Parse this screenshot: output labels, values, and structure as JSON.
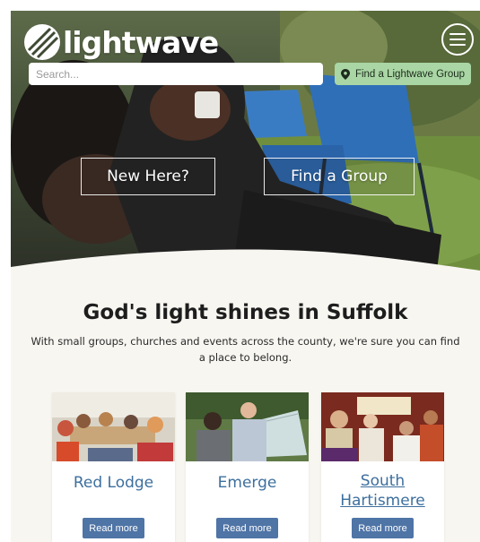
{
  "header": {
    "logo_text": "lightwave",
    "search": {
      "placeholder": "Search...",
      "value": ""
    },
    "find_group_label": "Find a Lightwave Group"
  },
  "hero": {
    "buttons": [
      {
        "label": "New Here?"
      },
      {
        "label": "Find a Group"
      }
    ]
  },
  "main": {
    "title": "God's light shines in Suffolk",
    "intro": "With small groups, churches and events across the county, we're sure you can find a place to belong.",
    "cards": [
      {
        "title": "Red Lodge",
        "button": "Read more"
      },
      {
        "title": "Emerge",
        "button": "Read more"
      },
      {
        "title": "South Hartismere",
        "button": "Read more"
      }
    ]
  },
  "colors": {
    "accent_green": "#a9d6a4",
    "link_blue": "#3d6f9e",
    "button_blue": "#4f74a6",
    "content_bg": "#f8f6f1"
  },
  "icons": [
    "lightwave-logo-icon",
    "menu-icon",
    "map-pin-icon"
  ]
}
